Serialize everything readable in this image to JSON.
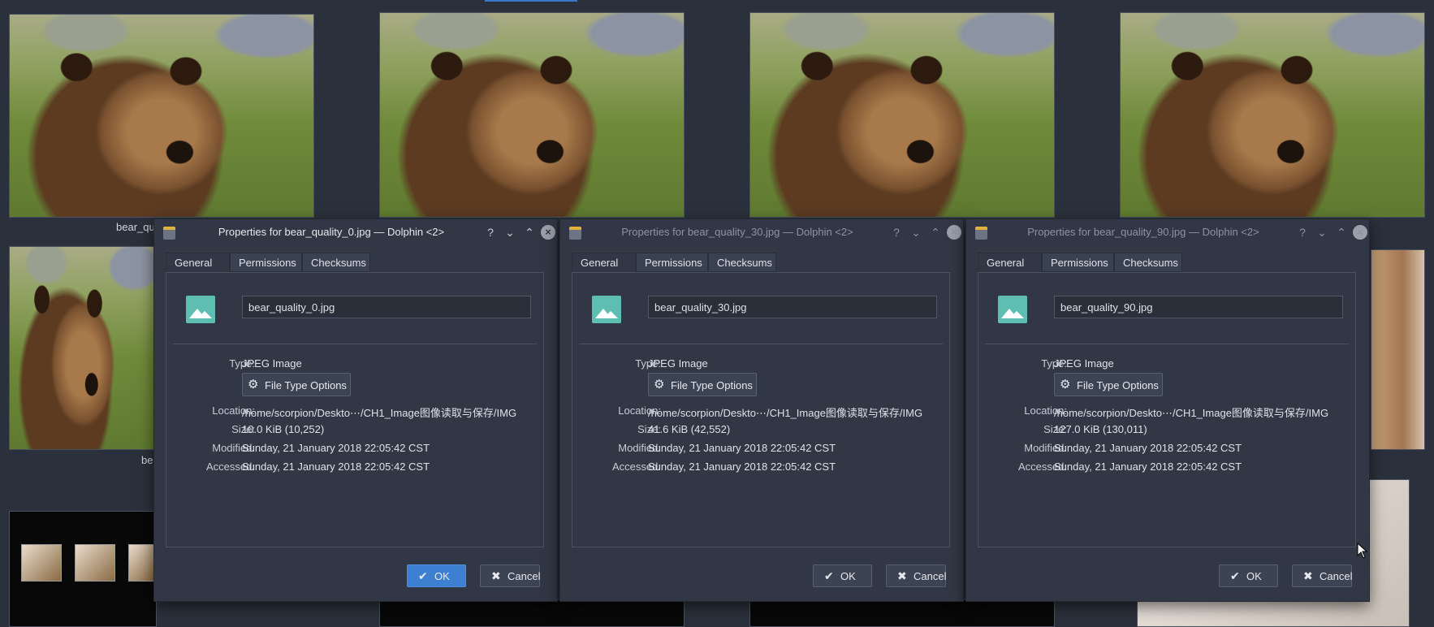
{
  "background": {
    "thumbnails_row1": [
      {
        "caption": ""
      },
      {
        "caption": ""
      },
      {
        "caption": ""
      },
      {
        "caption": ""
      }
    ],
    "caption_row2_left": "bear_qu",
    "caption_row3_left": "be"
  },
  "dialogs": [
    {
      "title": "Properties for bear_quality_0.jpg — Dolphin <2>",
      "active": true,
      "tabs": [
        "General",
        "Permissions",
        "Checksums"
      ],
      "filename": "bear_quality_0.jpg",
      "fields": {
        "type_label": "Type:",
        "type": "JPEG Image",
        "file_type_button": "File Type Options",
        "location_label": "Location:",
        "location": "/home/scorpion/Deskto⋯/CH1_Image图像读取与保存/IMG",
        "size_label": "Size:",
        "size": "10.0 KiB (10,252)",
        "modified_label": "Modified:",
        "modified": "Sunday, 21 January 2018 22:05:42 CST",
        "accessed_label": "Accessed:",
        "accessed": "Sunday, 21 January 2018 22:05:42 CST"
      },
      "ok_label": "OK",
      "cancel_label": "Cancel"
    },
    {
      "title": "Properties for bear_quality_30.jpg — Dolphin <2>",
      "active": false,
      "tabs": [
        "General",
        "Permissions",
        "Checksums"
      ],
      "filename": "bear_quality_30.jpg",
      "fields": {
        "type_label": "Type:",
        "type": "JPEG Image",
        "file_type_button": "File Type Options",
        "location_label": "Location:",
        "location": "/home/scorpion/Deskto⋯/CH1_Image图像读取与保存/IMG",
        "size_label": "Size:",
        "size": "41.6 KiB (42,552)",
        "modified_label": "Modified:",
        "modified": "Sunday, 21 January 2018 22:05:42 CST",
        "accessed_label": "Accessed:",
        "accessed": "Sunday, 21 January 2018 22:05:42 CST"
      },
      "ok_label": "OK",
      "cancel_label": "Cancel"
    },
    {
      "title": "Properties for bear_quality_90.jpg — Dolphin <2>",
      "active": false,
      "tabs": [
        "General",
        "Permissions",
        "Checksums"
      ],
      "filename": "bear_quality_90.jpg",
      "fields": {
        "type_label": "Type:",
        "type": "JPEG Image",
        "file_type_button": "File Type Options",
        "location_label": "Location:",
        "location": "/home/scorpion/Deskto⋯/CH1_Image图像读取与保存/IMG",
        "size_label": "Size:",
        "size": "127.0 KiB (130,011)",
        "modified_label": "Modified:",
        "modified": "Sunday, 21 January 2018 22:05:42 CST",
        "accessed_label": "Accessed:",
        "accessed": "Sunday, 21 January 2018 22:05:42 CST"
      },
      "ok_label": "OK",
      "cancel_label": "Cancel"
    }
  ],
  "icons": {
    "app": "dolphin-app-icon",
    "file": "image-file-icon",
    "help": "help-icon",
    "minimize": "minimize-icon",
    "maximize": "maximize-icon",
    "close": "close-icon",
    "gear": "gear-icon",
    "ok": "checkmark-icon",
    "cancel": "x-icon"
  },
  "colors": {
    "window_bg": "#313744",
    "desktop_bg": "#2b313c",
    "accent": "#3d7fd0",
    "file_icon": "#5fbeb2"
  }
}
